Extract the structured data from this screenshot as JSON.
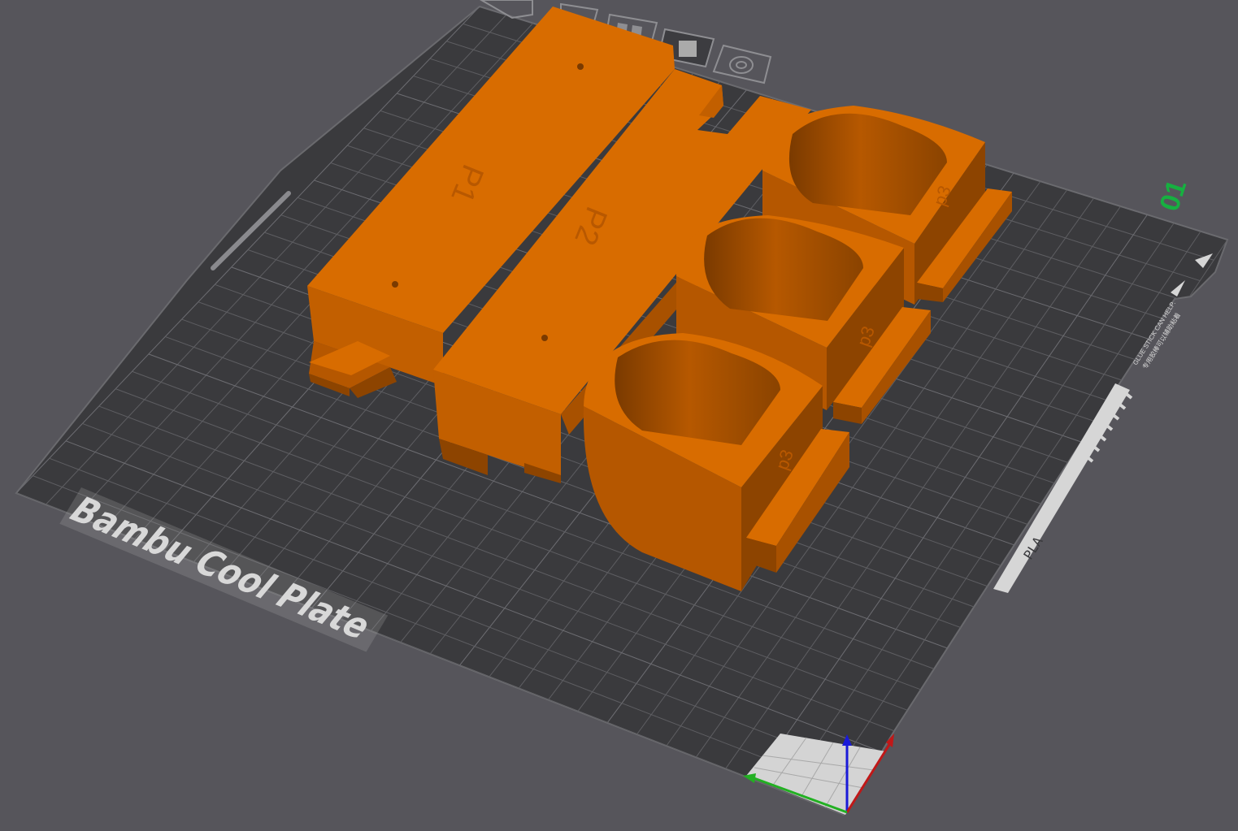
{
  "plate": {
    "name": "Bambu Cool Plate",
    "number": "01",
    "filament_label": "PLA",
    "warning_line1": "GLUE STICK CAN HELP.",
    "warning_line2": "专用胶棒可以辅助粘着"
  },
  "parts": {
    "label_p1": "P1",
    "label_p2": "P2",
    "label_p3": "p3"
  },
  "toolbar": {
    "icons": [
      "arrange-icon",
      "orient-icon",
      "layout-icon",
      "plate-settings-icon",
      "lock-icon"
    ]
  },
  "axes": {
    "x_color": "#c01818",
    "y_color": "#22b022",
    "z_color": "#1a1ad8"
  },
  "colors": {
    "background": "#56555b",
    "plate": "#3a3a3d",
    "grid": "#5e5e62",
    "part_top": "#d86c00",
    "part_side_light": "#c25f00",
    "part_side_dark": "#8d4400",
    "plate_number": "#16b040"
  }
}
